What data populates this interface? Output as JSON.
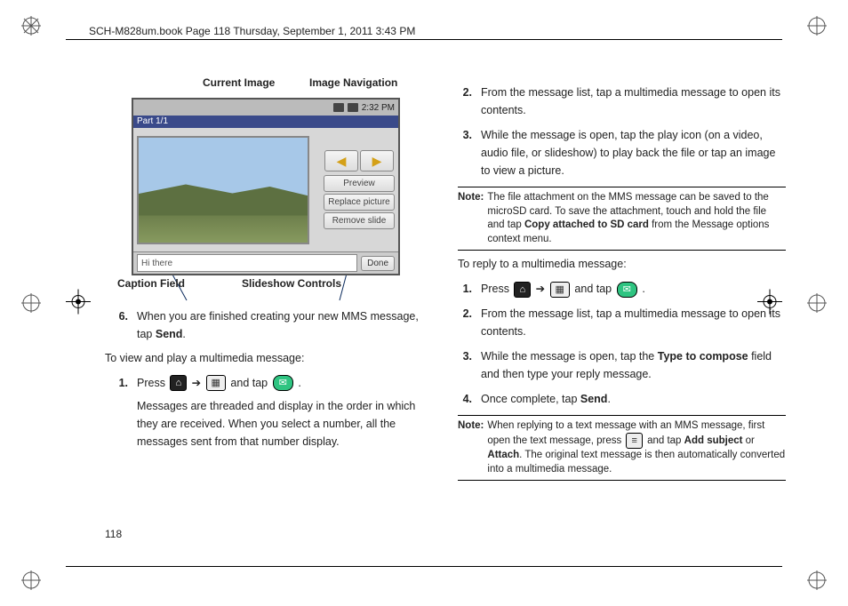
{
  "header": {
    "frame_text": "SCH-M828um.book  Page 118  Thursday, September 1, 2011  3:43 PM"
  },
  "page_number": "118",
  "figure": {
    "label_current": "Current Image",
    "label_nav": "Image Navigation",
    "label_caption": "Caption Field",
    "label_slide": "Slideshow Controls",
    "statusbar_time": "2:32 PM",
    "partbar": "Part 1/1",
    "arrow_prev": "◀",
    "arrow_next": "▶",
    "btn_preview": "Preview",
    "btn_replace": "Replace picture",
    "btn_remove": "Remove slide",
    "caption_value": "Hi there",
    "btn_done": "Done"
  },
  "left": {
    "step6_num": "6.",
    "step6_a": "When you are finished creating your new MMS message, tap ",
    "step6_b": "Send",
    "step6_c": ".",
    "view_intro": "To view and play a multimedia message:",
    "s1_num": "1.",
    "s1_a": "Press ",
    "s1_b": " ➔ ",
    "s1_c": " and tap ",
    "s1_d": " .",
    "s1_e": "Messages are threaded and display in the order in which they are received. When you select a number, all the messages sent from that number display."
  },
  "right": {
    "s2_num": "2.",
    "s2": "From the message list, tap a multimedia message to open its contents.",
    "s3_num": "3.",
    "s3": "While the message is open, tap the play icon (on a video, audio file, or slideshow) to play back the file or tap an image to view a picture.",
    "note1_tag": "Note:",
    "note1_a": "The file attachment on the MMS message can be saved to the microSD card. To save the attachment, touch and hold the file and tap ",
    "note1_b": "Copy attached to SD card",
    "note1_c": " from the Message options context menu.",
    "reply_intro": "To reply to a multimedia message:",
    "r1_num": "1.",
    "r1_a": "Press ",
    "r1_b": " ➔ ",
    "r1_c": " and tap ",
    "r1_d": " .",
    "r2_num": "2.",
    "r2": "From the message list, tap a multimedia message to open its contents.",
    "r3_num": "3.",
    "r3_a": "While the message is open, tap the ",
    "r3_b": "Type to compose",
    "r3_c": " field and then type your reply message.",
    "r4_num": "4.",
    "r4_a": "Once complete, tap ",
    "r4_b": "Send",
    "r4_c": ".",
    "note2_tag": "Note:",
    "note2_a": "When replying to a text message with an MMS message, first open the text message, press ",
    "note2_b": " and tap ",
    "note2_c": "Add subject",
    "note2_d": " or ",
    "note2_e": "Attach",
    "note2_f": ". The original text message is then automatically converted into a multimedia message."
  },
  "icons": {
    "home": "⌂",
    "grid": "▦",
    "msg": "✉",
    "menu": "≡"
  }
}
